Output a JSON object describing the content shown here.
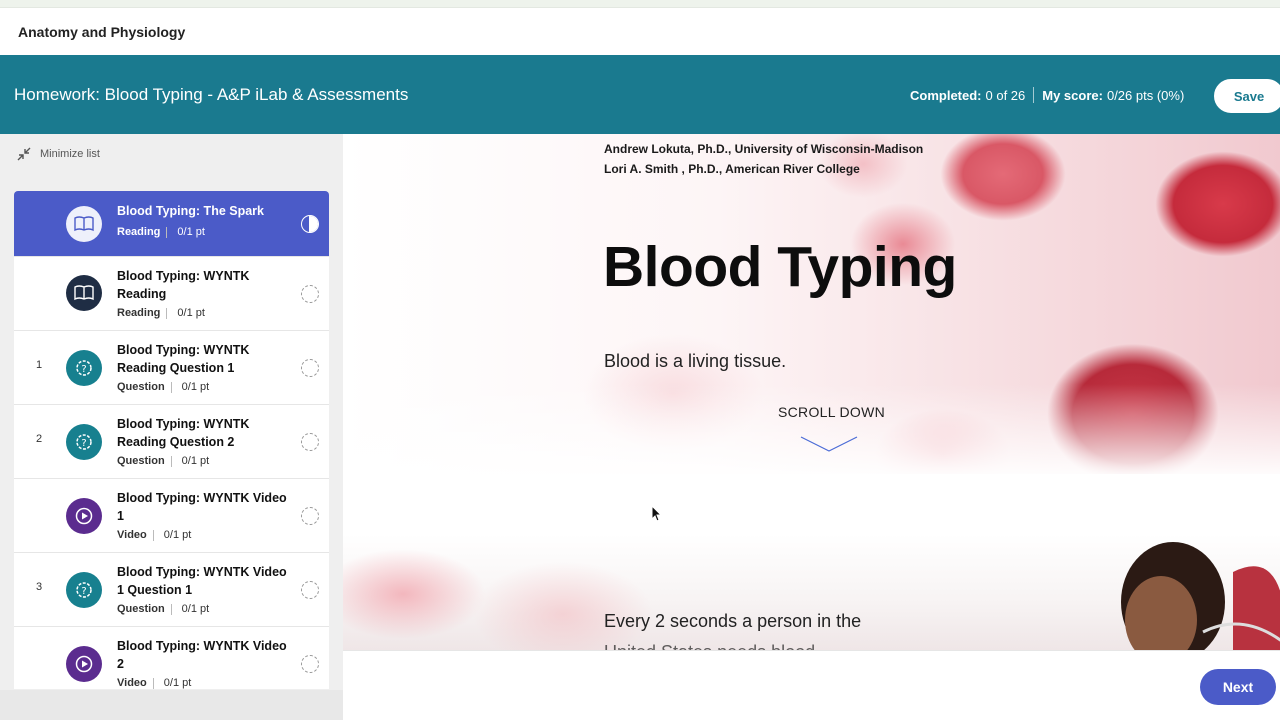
{
  "course": {
    "title": "Anatomy and Physiology"
  },
  "header": {
    "title": "Homework: Blood Typing - A&P iLab & Assessments",
    "completed_label": "Completed:",
    "completed_value": "0 of 26",
    "score_label": "My score:",
    "score_value": "0/26 pts (0%)",
    "save_label": "Save",
    "accent_color": "#1a7a8f"
  },
  "sidebar": {
    "minimize_label": "Minimize list",
    "items": [
      {
        "number": "",
        "title": "Blood Typing: The Spark",
        "type": "Reading",
        "points": "0/1 pt",
        "icon": "book-icon",
        "active": true
      },
      {
        "number": "",
        "title": "Blood Typing: WYNTK Reading",
        "type": "Reading",
        "points": "0/1 pt",
        "icon": "book-icon",
        "active": false
      },
      {
        "number": "1",
        "title": "Blood Typing: WYNTK Reading Question 1",
        "type": "Question",
        "points": "0/1 pt",
        "icon": "question-gear-icon",
        "active": false
      },
      {
        "number": "2",
        "title": "Blood Typing: WYNTK Reading Question 2",
        "type": "Question",
        "points": "0/1 pt",
        "icon": "question-gear-icon",
        "active": false
      },
      {
        "number": "",
        "title": "Blood Typing: WYNTK Video 1",
        "type": "Video",
        "points": "0/1 pt",
        "icon": "play-icon",
        "active": false
      },
      {
        "number": "3",
        "title": "Blood Typing: WYNTK Video 1 Question 1",
        "type": "Question",
        "points": "0/1 pt",
        "icon": "question-gear-icon",
        "active": false
      },
      {
        "number": "",
        "title": "Blood Typing: WYNTK Video 2",
        "type": "Video",
        "points": "0/1 pt",
        "icon": "play-icon",
        "active": false
      }
    ]
  },
  "content": {
    "author_1": "Andrew Lokuta, Ph.D., University of Wisconsin-Madison",
    "author_2": "Lori A. Smith , Ph.D., American River College",
    "title": "Blood Typing",
    "subtitle": "Blood is a living tissue.",
    "scroll_label": "SCROLL DOWN",
    "lower_text": "Every 2 seconds a person in the",
    "lower_text_cut": "United States needs blood"
  },
  "footer": {
    "next_label": "Next",
    "button_color": "#4b5bc8"
  }
}
